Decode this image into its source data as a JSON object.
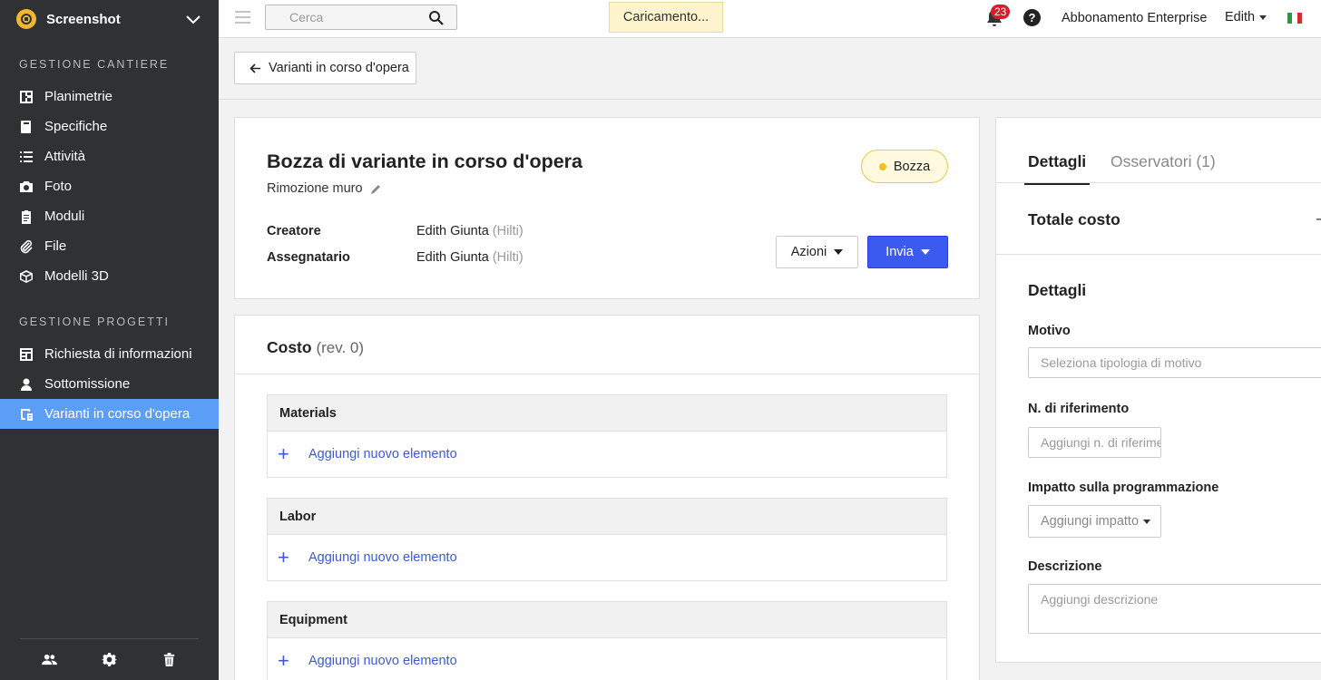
{
  "app": {
    "name": "Screenshot"
  },
  "sidebar": {
    "section1": "GESTIONE CANTIERE",
    "items1": [
      {
        "label": "Planimetrie",
        "icon": "floorplan-icon"
      },
      {
        "label": "Specifiche",
        "icon": "book-icon"
      },
      {
        "label": "Attività",
        "icon": "list-icon"
      },
      {
        "label": "Foto",
        "icon": "camera-icon"
      },
      {
        "label": "Moduli",
        "icon": "clipboard-icon"
      },
      {
        "label": "File",
        "icon": "paperclip-icon"
      },
      {
        "label": "Modelli 3D",
        "icon": "cube-icon"
      }
    ],
    "section2": "GESTIONE PROGETTI",
    "items2": [
      {
        "label": "Richiesta di informazioni",
        "icon": "info-request-icon"
      },
      {
        "label": "Sottomissione",
        "icon": "person-icon"
      },
      {
        "label": "Varianti in corso d'opera",
        "icon": "change-order-icon",
        "active": true
      }
    ]
  },
  "topbar": {
    "search_placeholder": "Cerca",
    "loading": "Caricamento...",
    "notifications_count": "23",
    "help": "?",
    "subscription": "Abbonamento Enterprise",
    "user": "Edith"
  },
  "back": {
    "label": "Varianti in corso d'opera"
  },
  "header": {
    "title": "Bozza di variante in corso d'opera",
    "subtitle": "Rimozione muro",
    "status": "Bozza",
    "creator_label": "Creatore",
    "creator_name": "Edith Giunta",
    "creator_company": "(Hilti)",
    "assignee_label": "Assegnatario",
    "assignee_name": "Edith Giunta",
    "assignee_company": "(Hilti)",
    "actions_label": "Azioni",
    "send_label": "Invia"
  },
  "cost": {
    "title": "Costo",
    "rev": "(rev. 0)",
    "groups": [
      {
        "name": "Materials",
        "add": "Aggiungi nuovo elemento"
      },
      {
        "name": "Labor",
        "add": "Aggiungi nuovo elemento"
      },
      {
        "name": "Equipment",
        "add": "Aggiungi nuovo elemento"
      }
    ]
  },
  "details": {
    "tab_details": "Dettagli",
    "tab_observers": "Osservatori",
    "observers_count": "(1)",
    "total_label": "Totale costo",
    "total_value": "–",
    "section_title": "Dettagli",
    "motivo_label": "Motivo",
    "motivo_placeholder": "Seleziona tipologia di motivo",
    "ref_label": "N. di riferimento",
    "ref_placeholder": "Aggiungi n. di riferimento",
    "impact_label": "Impatto sulla programmazione",
    "impact_placeholder": "Aggiungi impatto",
    "desc_label": "Descrizione",
    "desc_placeholder": "Aggiungi descrizione"
  },
  "colors": {
    "accent": "#3a5af0",
    "sidebar": "#2f3133",
    "active": "#5b9ef5",
    "status": "#f2c01a"
  }
}
